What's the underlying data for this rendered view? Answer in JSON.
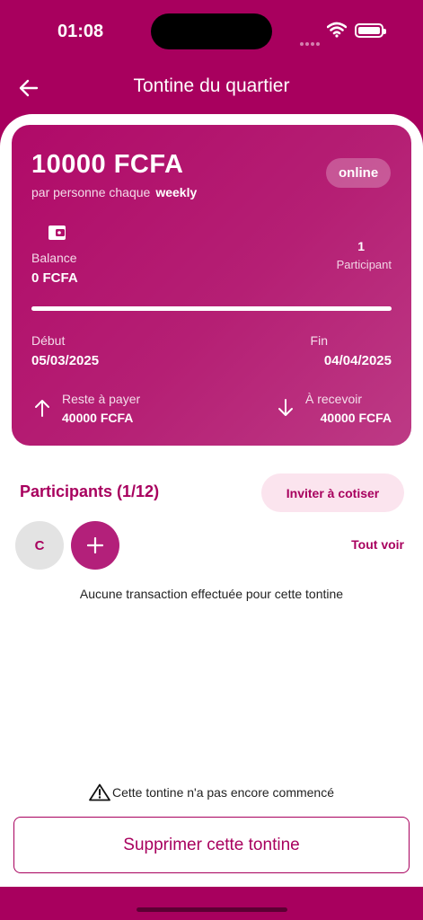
{
  "status": {
    "time": "01:08"
  },
  "header": {
    "title": "Tontine du quartier"
  },
  "card": {
    "amount": "10000 FCFA",
    "frequency_prefix": "par personne chaque",
    "frequency": "weekly",
    "status_badge": "online",
    "balance_label": "Balance",
    "balance_value": "0 FCFA",
    "participant_count": "1",
    "participant_label": "Participant",
    "progress": 1.0,
    "start_label": "Début",
    "start_date": "05/03/2025",
    "end_label": "Fin",
    "end_date": "04/04/2025",
    "to_pay_label": "Reste à payer",
    "to_pay_value": "40000 FCFA",
    "to_receive_label": "À recevoir",
    "to_receive_value": "40000 FCFA"
  },
  "participants": {
    "title": "Participants (1/12)",
    "invite_label": "Inviter à cotiser",
    "avatar_initial": "C",
    "see_all_label": "Tout voir",
    "empty_message": "Aucune transaction effectuée pour cette tontine"
  },
  "footer": {
    "warning_text": "Cette tontine n'a pas encore commencé",
    "delete_label": "Supprimer cette tontine"
  },
  "colors": {
    "primary": "#a8005e",
    "invite_bg": "#fbe4ee"
  },
  "icons": [
    "back-arrow-icon",
    "wallet-icon",
    "arrow-up-icon",
    "arrow-down-icon",
    "plus-icon",
    "warning-icon",
    "wifi-icon",
    "battery-icon"
  ]
}
